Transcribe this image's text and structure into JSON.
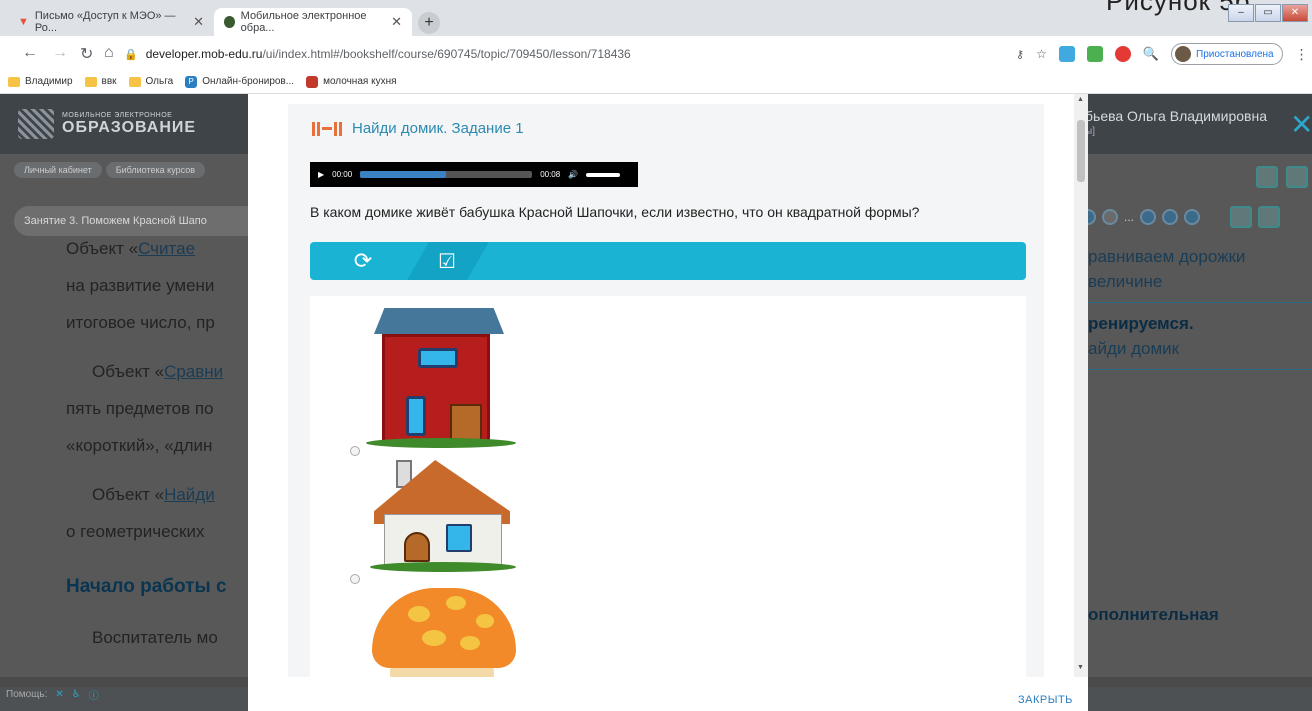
{
  "tabs": [
    {
      "title": "Письмо «Доступ к МЭО» — Ро...",
      "icon": "mail-icon"
    },
    {
      "title": "Мобильное электронное обра...",
      "icon": "site-icon"
    }
  ],
  "corner_text": "Рисунок 5б",
  "address": {
    "domain": "developer.mob-edu.ru",
    "path": "/ui/index.html#/bookshelf/course/690745/topic/709450/lesson/718436"
  },
  "profile": {
    "status": "Приостановлена"
  },
  "bookmarks": [
    "Владимир",
    "ввк",
    "Ольга",
    "Онлайн-брониров...",
    "молочная кухня"
  ],
  "site": {
    "logo_small": "МОБИЛЬНОЕ ЭЛЕКТРОННОЕ",
    "logo_big": "ОБРАЗОВАНИЕ",
    "user_name": "бьева Ольга Владимировна",
    "user_level": "ы]",
    "breadcrumbs": [
      "Личный кабинет",
      "Библиотека курсов"
    ],
    "lesson_select": "Занятие 3. Поможем Красной Шапо",
    "pager_ellipsis": "...",
    "bg_text": {
      "l1": "Объект «",
      "l1u": "Считае",
      "l2": "на развитие умени",
      "l3": "итоговое число, пр",
      "l4": "Объект «",
      "l4u": "Сравни",
      "l5": "пять предметов по",
      "l6": "«короткий», «длин",
      "l7": "Объект «",
      "l7u": "Найди",
      "l8": "о геометрических",
      "heading": "Начало работы с",
      "l9": "Воспитатель мо"
    },
    "right_col": {
      "a1": "равниваем дорожки",
      "a2": "величине",
      "b1": "ренируемся.",
      "b2": "айди домик",
      "c1": "ополнительная"
    },
    "help_label": "Помощь:"
  },
  "modal": {
    "task_title": "Найди домик. Задание 1",
    "audio": {
      "current": "00:00",
      "total": "00:08",
      "progress": 0.5
    },
    "question": "В каком домике живёт бабушка Красной Шапочки, если известно, что он квадратной формы?",
    "toolbar": {
      "refresh": "refresh-icon",
      "check": "check-icon"
    },
    "options": [
      {
        "name": "red-house"
      },
      {
        "name": "white-house"
      },
      {
        "name": "mushroom-house"
      }
    ],
    "close_label": "ЗАКРЫТЬ"
  },
  "colors": {
    "accent": "#1ab3d4",
    "link": "#2d8ab0",
    "orange": "#e8703a"
  }
}
